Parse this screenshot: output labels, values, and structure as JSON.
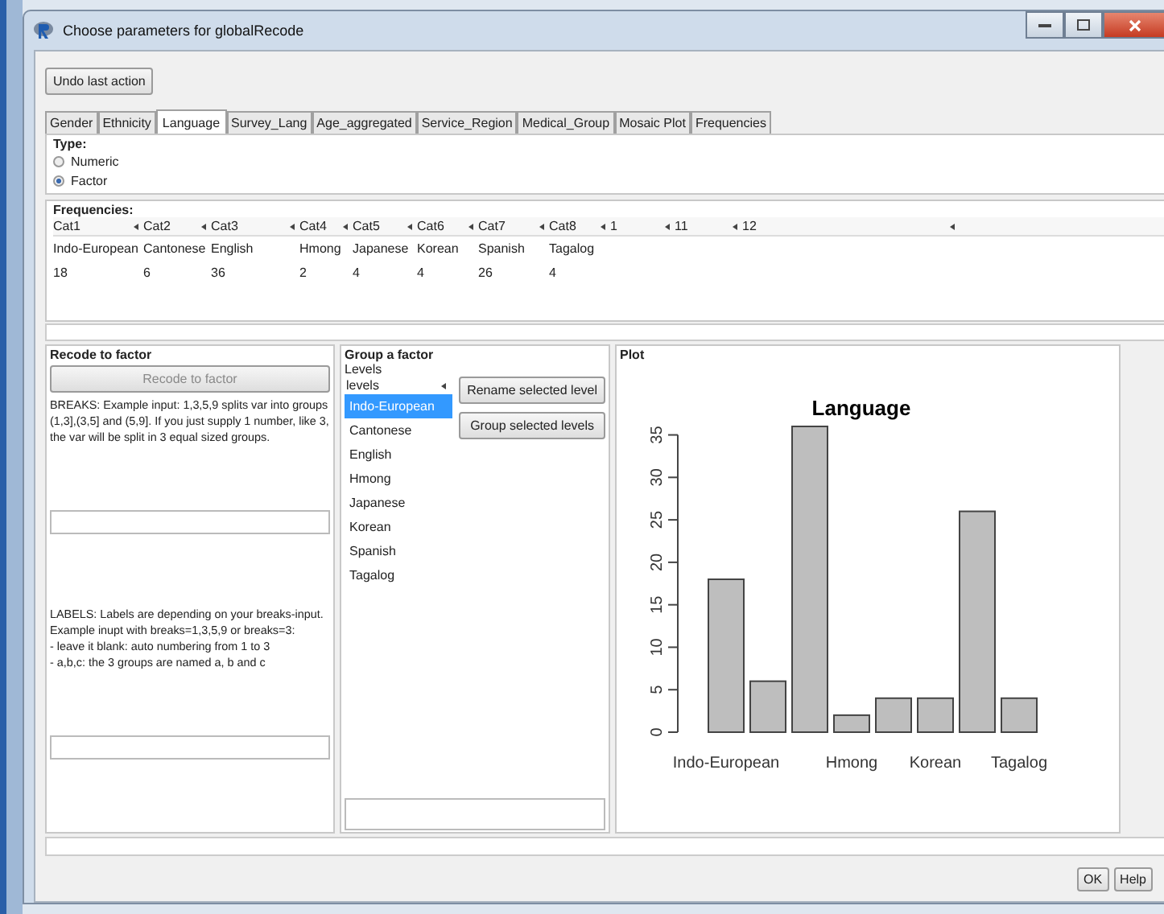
{
  "window": {
    "title": "Choose parameters for globalRecode"
  },
  "undo_button": "Undo last action",
  "tabs": [
    {
      "label": "Gender",
      "selected": false
    },
    {
      "label": "Ethnicity",
      "selected": false
    },
    {
      "label": "Language",
      "selected": true
    },
    {
      "label": "Survey_Lang",
      "selected": false
    },
    {
      "label": "Age_aggregated",
      "selected": false
    },
    {
      "label": "Service_Region",
      "selected": false
    },
    {
      "label": "Medical_Group",
      "selected": false
    },
    {
      "label": "Mosaic Plot",
      "selected": false
    },
    {
      "label": "Frequencies",
      "selected": false
    }
  ],
  "type": {
    "title": "Type:",
    "options": [
      {
        "label": "Numeric",
        "selected": false
      },
      {
        "label": "Factor",
        "selected": true
      }
    ]
  },
  "frequencies": {
    "title": "Frequencies:",
    "columns": [
      "Cat1",
      "Cat2",
      "Cat3",
      "Cat4",
      "Cat5",
      "Cat6",
      "Cat7",
      "Cat8",
      "1",
      "11",
      "12"
    ],
    "rows": [
      [
        "Indo-European",
        "Cantonese",
        "English",
        "Hmong",
        "Japanese",
        "Korean",
        "Spanish",
        "Tagalog"
      ],
      [
        "18",
        "6",
        "36",
        "2",
        "4",
        "4",
        "26",
        "4"
      ]
    ]
  },
  "recode": {
    "title": "Recode to factor",
    "button": "Recode to factor",
    "breaks_help": "BREAKS: Example input: 1,3,5,9 splits var into groups (1,3],(3,5] and (5,9]. If you just supply 1 number, like 3, the var will be split in 3 equal sized groups.",
    "labels_help": [
      "LABELS: Labels are depending on your breaks-input.",
      "Example inupt with breaks=1,3,5,9 or breaks=3:",
      "- leave it blank: auto numbering from 1 to 3",
      "- a,b,c: the 3 groups are named a, b and c"
    ]
  },
  "group": {
    "title": "Group a factor",
    "levels_title": "Levels",
    "list_header": "levels",
    "levels": [
      {
        "label": "Indo-European",
        "selected": true
      },
      {
        "label": "Cantonese",
        "selected": false
      },
      {
        "label": "English",
        "selected": false
      },
      {
        "label": "Hmong",
        "selected": false
      },
      {
        "label": "Japanese",
        "selected": false
      },
      {
        "label": "Korean",
        "selected": false
      },
      {
        "label": "Spanish",
        "selected": false
      },
      {
        "label": "Tagalog",
        "selected": false
      }
    ],
    "buttons": [
      "Rename selected level",
      "Group selected levels"
    ]
  },
  "plot": {
    "title": "Plot",
    "chart_data": {
      "type": "bar",
      "title": "Language",
      "categories": [
        "Indo-European",
        null,
        null,
        "Hmong",
        null,
        "Korean",
        null,
        "Tagalog"
      ],
      "values": [
        18,
        6,
        36,
        2,
        4,
        4,
        26,
        4
      ],
      "ylim": [
        0,
        36
      ],
      "yticks": [
        0,
        5,
        10,
        15,
        20,
        25,
        30,
        35
      ]
    }
  },
  "buttons": [
    "OK",
    "Help"
  ]
}
